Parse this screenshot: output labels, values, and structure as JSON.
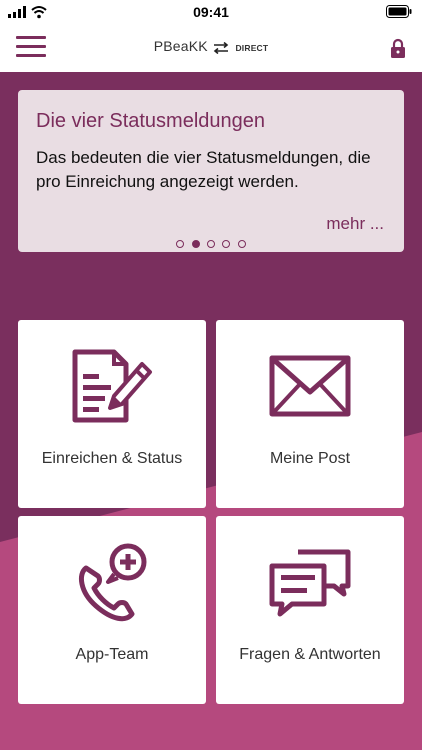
{
  "status_bar": {
    "time": "09:41"
  },
  "header": {
    "logo_primary": "PBeaKK",
    "logo_secondary": "DIRECT"
  },
  "banner": {
    "title": "Die vier Statusmeldungen",
    "text": "Das bedeuten die vier Statusmeldungen, die pro Einreichung angezeigt werden.",
    "more_label": "mehr ...",
    "page_count": 5,
    "active_page": 2
  },
  "tiles": [
    {
      "label": "Einreichen & Status",
      "icon": "document-edit-icon"
    },
    {
      "label": "Meine Post",
      "icon": "envelope-icon"
    },
    {
      "label": "App-Team",
      "icon": "phone-add-icon"
    },
    {
      "label": "Fragen & Antworten",
      "icon": "chat-bubbles-icon"
    }
  ],
  "colors": {
    "brand": "#7b2d5c",
    "background_dark": "#7a2f5e",
    "background_light": "#b5497e",
    "banner_bg": "#e9dde3"
  }
}
